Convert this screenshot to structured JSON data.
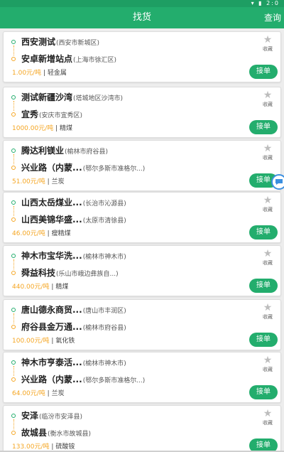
{
  "status_bar": {
    "time": "2:0"
  },
  "header": {
    "title": "找货",
    "action_label": "查询"
  },
  "favorite_label": "收藏",
  "take_order_label": "接单",
  "colors": {
    "brand_green": "#23ad6d",
    "price_orange": "#f5a623",
    "float_blue": "#3b8fe0"
  },
  "icons": {
    "favorite": "star-icon",
    "origin": "origin-dot-icon",
    "destination": "destination-dot-icon",
    "float": "chat-bubble-icon"
  },
  "orders": [
    {
      "from_name": "西安测试",
      "from_area": "(西安市新城区)",
      "to_name": "安卓新增站点",
      "to_area": "(上海市徐汇区)",
      "price": "1.00",
      "unit": "元/吨",
      "cargo": "轻金属"
    },
    {
      "from_name": "测试新疆沙湾",
      "from_area": "(塔城地区沙湾市)",
      "to_name": "宜秀",
      "to_area": "(安庆市宜秀区)",
      "price": "1000.00",
      "unit": "元/吨",
      "cargo": "精煤"
    },
    {
      "from_name": "腾达利镁业",
      "from_area": "(榆林市府谷县)",
      "to_name": "兴业路（内蒙...",
      "to_area": "(鄂尔多斯市准格尔...)",
      "price": "51.00",
      "unit": "元/吨",
      "cargo": "兰炭"
    },
    {
      "from_name": "山西太岳煤业...",
      "from_area": "(长治市沁源县)",
      "to_name": "山西美锦华盛...",
      "to_area": "(太原市清徐县)",
      "price": "46.00",
      "unit": "元/吨",
      "cargo": "瘦精煤"
    },
    {
      "from_name": "神木市宝华洗...",
      "from_area": "(榆林市神木市)",
      "to_name": "舜益科技",
      "to_area": "(乐山市峨边彝族自...)",
      "price": "440.00",
      "unit": "元/吨",
      "cargo": "精煤"
    },
    {
      "from_name": "唐山德永商贸...",
      "from_area": "(唐山市丰润区)",
      "to_name": "府谷县金万通...",
      "to_area": "(榆林市府谷县)",
      "price": "100.00",
      "unit": "元/吨",
      "cargo": "氧化铁"
    },
    {
      "from_name": "神木市亨泰活...",
      "from_area": "(榆林市神木市)",
      "to_name": "兴业路（内蒙...",
      "to_area": "(鄂尔多斯市准格尔...)",
      "price": "64.00",
      "unit": "元/吨",
      "cargo": "兰炭"
    },
    {
      "from_name": "安泽",
      "from_area": "(临汾市安泽县)",
      "to_name": "故城县",
      "to_area": "(衡水市故城县)",
      "price": "133.00",
      "unit": "元/吨",
      "cargo": "硫酸铵"
    }
  ]
}
